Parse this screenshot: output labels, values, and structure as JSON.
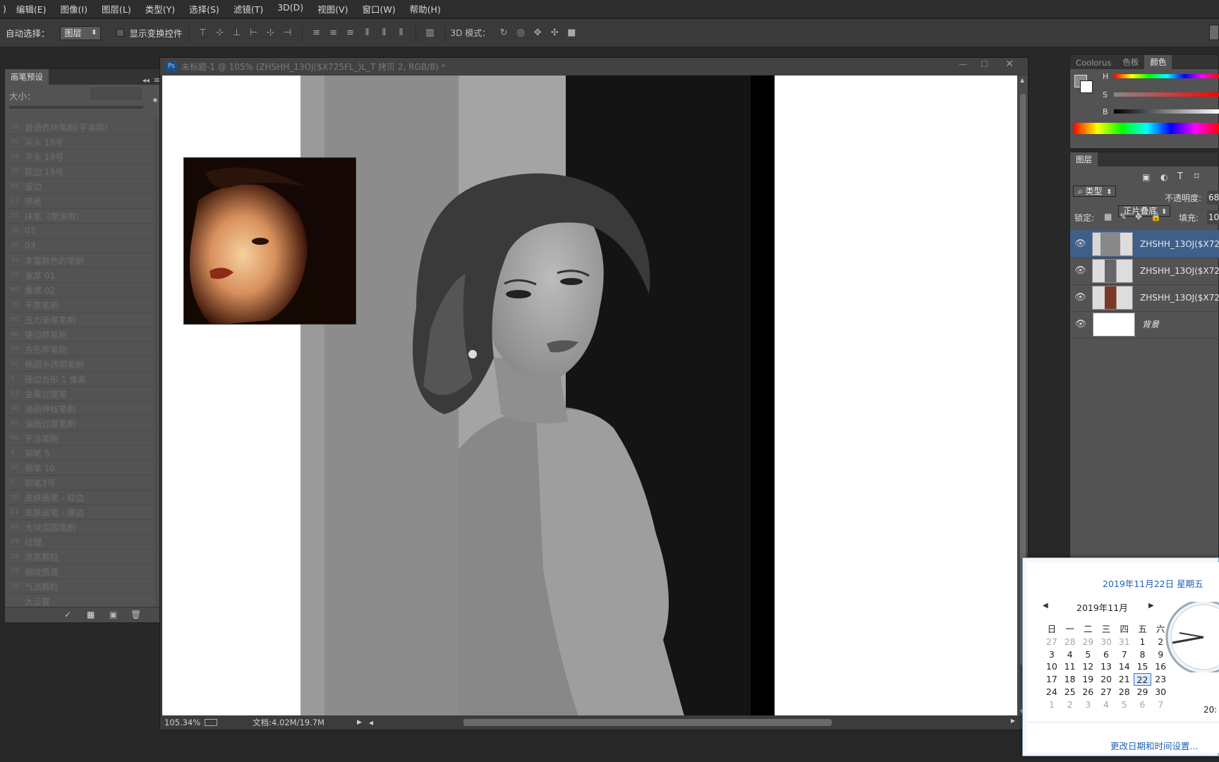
{
  "menu": [
    "编辑(E)",
    "图像(I)",
    "图层(L)",
    "类型(Y)",
    "选择(S)",
    "滤镜(T)",
    "3D(D)",
    "视图(V)",
    "窗口(W)",
    "帮助(H)"
  ],
  "options": {
    "auto_select_label": "自动选择：",
    "auto_select_value": "图层",
    "show_transform_label": "显示变换控件",
    "mode_3d_label": "3D 模式："
  },
  "brush_panel": {
    "tab": "画笔预设",
    "size_label": "大小：",
    "brushes": [
      {
        "n": "30",
        "name": "普通色块笔刷(平涂用)"
      },
      {
        "n": "10",
        "name": "尖头 19号"
      },
      {
        "n": "19",
        "name": "平头 19号"
      },
      {
        "n": "30",
        "name": "软边 19号"
      },
      {
        "n": "64",
        "name": "蛋边"
      },
      {
        "n": "17",
        "name": "喷枪"
      },
      {
        "n": "15",
        "name": "抹笔（厚涂用）"
      },
      {
        "n": "30",
        "name": "03"
      },
      {
        "n": "30",
        "name": "03"
      },
      {
        "n": "35",
        "name": "丰富颜色的笔刷"
      },
      {
        "n": "50",
        "name": "重厚 01"
      },
      {
        "n": "60",
        "name": "重厚 02"
      },
      {
        "n": "70",
        "name": "干厚笔刷"
      },
      {
        "n": "90",
        "name": "压力渐厚笔刷"
      },
      {
        "n": "40",
        "name": "硬边厚笔刷"
      },
      {
        "n": "50",
        "name": "方形厚笔刷"
      },
      {
        "n": "50",
        "name": "椭圆半透明笔刷"
      },
      {
        "n": "1",
        "name": "硬边方形 1 像素"
      },
      {
        "n": "63",
        "name": "金属过度笔"
      },
      {
        "n": "40",
        "name": "油画伸线笔刷"
      },
      {
        "n": "40",
        "name": "油画过度笔刷"
      },
      {
        "n": "60",
        "name": "干法笔刷"
      },
      {
        "n": "5",
        "name": "钢笔 5"
      },
      {
        "n": "10",
        "name": "钢笔 10"
      },
      {
        "n": "5",
        "name": "钢笔3号"
      },
      {
        "n": "10",
        "name": "皮肤画笔 - 软边"
      },
      {
        "n": "11",
        "name": "皮肤画笔 - 硬边"
      },
      {
        "n": "49",
        "name": "大块混国笔刷"
      },
      {
        "n": "29",
        "name": "纹理"
      },
      {
        "n": "29",
        "name": "浓黑颗粒"
      },
      {
        "n": "29",
        "name": "细纹质感"
      },
      {
        "n": "30",
        "name": "气流颗粒"
      },
      {
        "n": "",
        "name": "大云雾"
      }
    ]
  },
  "document": {
    "title": "未标题-1 @ 105% (ZHSHH_13OJ($X725FL_)L_T 拷贝 2, RGB/8) *",
    "zoom": "105.34%",
    "doc_info": "文档:4.02M/19.7M"
  },
  "color_panel": {
    "tabs": [
      "Coolorus",
      "色板",
      "颜色"
    ],
    "h_label": "H",
    "s_label": "S",
    "b_label": "B"
  },
  "layers_panel": {
    "tab": "图层",
    "filter_value": "类型",
    "blend_mode": "正片叠底",
    "opacity_label": "不透明度:",
    "opacity_value": "68",
    "lock_label": "锁定:",
    "fill_label": "填充:",
    "fill_value": "10",
    "layers": [
      {
        "name": "ZHSHH_13OJ($X72",
        "selected": true
      },
      {
        "name": "ZHSHH_13OJ($X72",
        "selected": false
      },
      {
        "name": "ZHSHH_13OJ($X72",
        "selected": false
      },
      {
        "name": "背景",
        "selected": false
      }
    ]
  },
  "calendar": {
    "date_header": "2019年11月22日 星期五",
    "month_label": "2019年11月",
    "weekdays": [
      "日",
      "一",
      "二",
      "三",
      "四",
      "五",
      "六"
    ],
    "weeks": [
      [
        "27",
        "28",
        "29",
        "30",
        "31",
        "1",
        "2"
      ],
      [
        "3",
        "4",
        "5",
        "6",
        "7",
        "8",
        "9"
      ],
      [
        "10",
        "11",
        "12",
        "13",
        "14",
        "15",
        "16"
      ],
      [
        "17",
        "18",
        "19",
        "20",
        "21",
        "22",
        "23"
      ],
      [
        "24",
        "25",
        "26",
        "27",
        "28",
        "29",
        "30"
      ],
      [
        "1",
        "2",
        "3",
        "4",
        "5",
        "6",
        "7"
      ]
    ],
    "today": "22",
    "clock_text": "20:",
    "change_link": "更改日期和时间设置..."
  }
}
